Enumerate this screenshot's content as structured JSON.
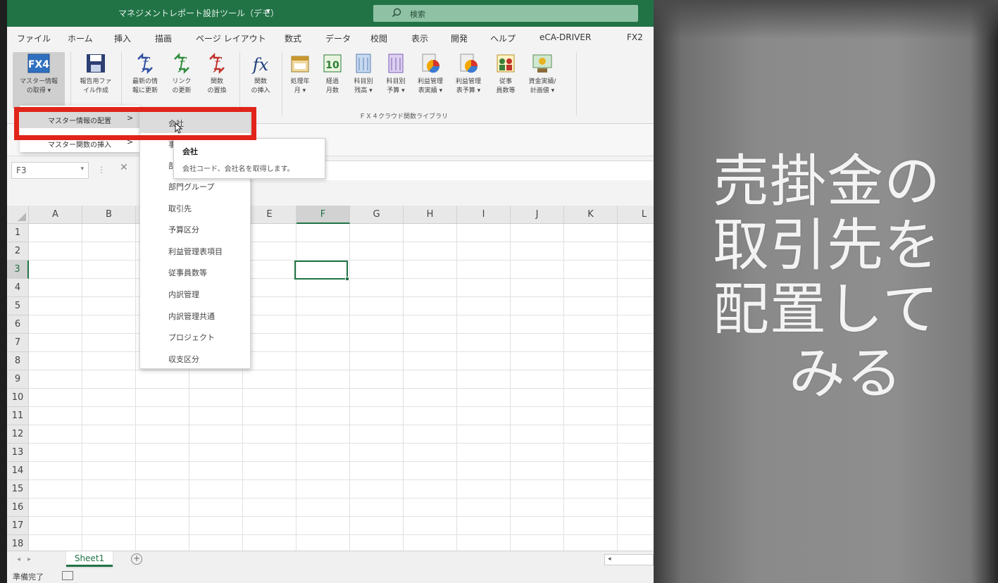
{
  "titlebar": {
    "title": "マネジメントレポート設計ツール（デモ）",
    "caret": "▾",
    "search_placeholder": "検索"
  },
  "tabs": [
    "ファイル",
    "ホーム",
    "挿入",
    "描画",
    "ページ レイアウト",
    "数式",
    "データ",
    "校閲",
    "表示",
    "開発",
    "ヘルプ",
    "eCA-DRIVER",
    "FX2"
  ],
  "ribbon": {
    "buttons": [
      {
        "label": "マスター情報\nの取得 ▾",
        "icon": "fx4-icon"
      },
      {
        "label": "報告用ファ\nイル作成",
        "icon": "save-icon"
      },
      {
        "label": "最新の情\n報に更新",
        "icon": "refresh-latest-icon"
      },
      {
        "label": "リンク\nの更新",
        "icon": "link-update-icon"
      },
      {
        "label": "関数\nの置換",
        "icon": "function-replace-icon"
      },
      {
        "label": "関数\nの挿入",
        "icon": "insert-function-icon"
      },
      {
        "label": "処理年\n月 ▾",
        "icon": "calendar-icon"
      },
      {
        "label": "経過\n月数",
        "icon": "calendar-10-icon"
      },
      {
        "label": "科目別\n残高 ▾",
        "icon": "account-balance-icon"
      },
      {
        "label": "科目別\n予算 ▾",
        "icon": "account-budget-icon"
      },
      {
        "label": "利益管理\n表実績 ▾",
        "icon": "profit-actual-icon"
      },
      {
        "label": "利益管理\n表予算 ▾",
        "icon": "profit-budget-icon"
      },
      {
        "label": "従事\n員数等",
        "icon": "employees-icon"
      },
      {
        "label": "資金実績/\n計画値 ▾",
        "icon": "fund-icon"
      }
    ],
    "group_label": "ＦＸ４クラウド関数ライブラリ"
  },
  "namebox": {
    "value": "F3"
  },
  "grid": {
    "columns": [
      "A",
      "B",
      "C",
      "D",
      "E",
      "F",
      "G",
      "H",
      "I",
      "J",
      "K",
      "L"
    ],
    "rows": [
      "1",
      "2",
      "3",
      "4",
      "5",
      "6",
      "7",
      "8",
      "9",
      "10",
      "11",
      "12",
      "13",
      "14",
      "15",
      "16",
      "17",
      "18"
    ],
    "active_column": "F",
    "active_row": "3"
  },
  "menu_master": [
    {
      "label": "マスター情報の配置",
      "arrow": ">"
    },
    {
      "label": "マスター関数の挿入",
      "arrow": ">"
    }
  ],
  "submenu": [
    "会社",
    "事業所",
    "部門",
    "部門グループ",
    "取引先",
    "予算区分",
    "利益管理表項目",
    "従事員数等",
    "内訳管理",
    "内訳管理共通",
    "プロジェクト",
    "収支区分"
  ],
  "tooltip": {
    "title": "会社",
    "description": "会社コード、会社名を取得します。"
  },
  "sheets": {
    "tab": "Sheet1",
    "add": "+"
  },
  "status": {
    "text": "準備完了"
  },
  "caption": {
    "lines": [
      "売掛金の",
      "取引先を",
      "配置して",
      "みる"
    ]
  },
  "colors": {
    "excel_green": "#217346",
    "highlight_red": "#e0241a"
  }
}
